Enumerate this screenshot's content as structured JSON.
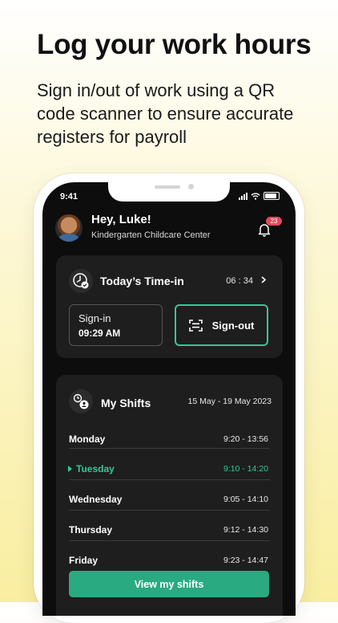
{
  "promo": {
    "headline": "Log your work hours",
    "subline": "Sign in/out of work using a QR code scanner to ensure accurate registers for payroll"
  },
  "status_bar": {
    "time": "9:41"
  },
  "header": {
    "greeting": "Hey, Luke!",
    "organization": "Kindergarten Childcare Center",
    "notification_count": "23"
  },
  "time_card": {
    "title": "Today’s Time-in",
    "elapsed": "06 : 34",
    "signin_label": "Sign-in",
    "signin_time": "09:29 AM",
    "signout_label": "Sign-out"
  },
  "shifts_card": {
    "title": "My Shifts",
    "date_range": "15 May - 19 May 2023",
    "shifts": [
      {
        "day": "Monday",
        "hours": "9:20 - 13:56"
      },
      {
        "day": "Tuesday",
        "hours": "9:10 - 14:20"
      },
      {
        "day": "Wednesday",
        "hours": "9:05 - 14:10"
      },
      {
        "day": "Thursday",
        "hours": "9:12 - 14:30"
      },
      {
        "day": "Friday",
        "hours": "9:23 - 14:47"
      }
    ],
    "active_day": "Tuesday",
    "view_button": "View my shifts"
  },
  "colors": {
    "accent": "#35c896",
    "button": "#2aaa80",
    "badge": "#e24a5a",
    "screen_bg": "#0d0d0d",
    "card_bg": "#1e1e1e"
  },
  "icons": [
    "clock-check-icon",
    "chevron-right-icon",
    "qr-scan-icon",
    "shift-person-icon",
    "bell-icon"
  ]
}
